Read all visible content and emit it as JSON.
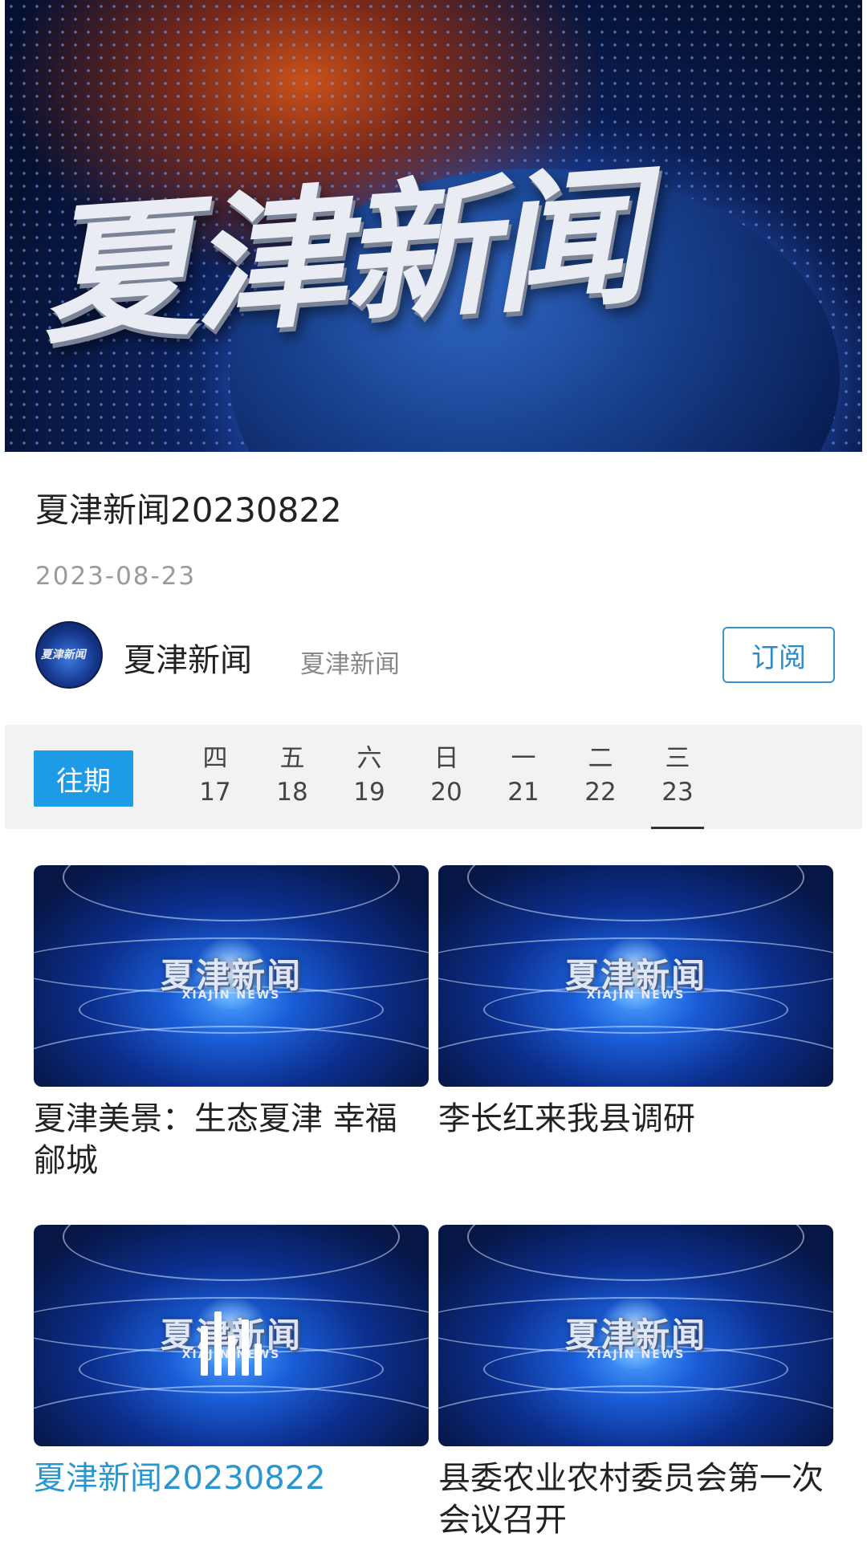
{
  "hero": {
    "overlay_text": "夏津新闻"
  },
  "video": {
    "title": "夏津新闻20230822",
    "date": "2023-08-23"
  },
  "channel": {
    "avatar_text": "夏津新闻",
    "name": "夏津新闻",
    "sub": "夏津新闻",
    "subscribe_label": "订阅"
  },
  "date_strip": {
    "past_label": "往期",
    "days": [
      {
        "weekday": "四",
        "day": "17"
      },
      {
        "weekday": "五",
        "day": "18"
      },
      {
        "weekday": "六",
        "day": "19"
      },
      {
        "weekday": "日",
        "day": "20"
      },
      {
        "weekday": "一",
        "day": "21"
      },
      {
        "weekday": "二",
        "day": "22"
      },
      {
        "weekday": "三",
        "day": "23",
        "selected": true
      }
    ]
  },
  "thumb_logo": {
    "cn": "夏津新闻",
    "en": "XIAJIN NEWS"
  },
  "cards": [
    {
      "title": "夏津美景：生态夏津  幸福鄃城"
    },
    {
      "title": "李长红来我县调研"
    },
    {
      "title": "夏津新闻20230822",
      "playing": true
    },
    {
      "title": "县委农业农村委员会第一次会议召开"
    }
  ],
  "colors": {
    "accent_blue": "#1e9be6",
    "playing_text": "#2a95cf",
    "subscribe_border": "#3a93c6"
  }
}
